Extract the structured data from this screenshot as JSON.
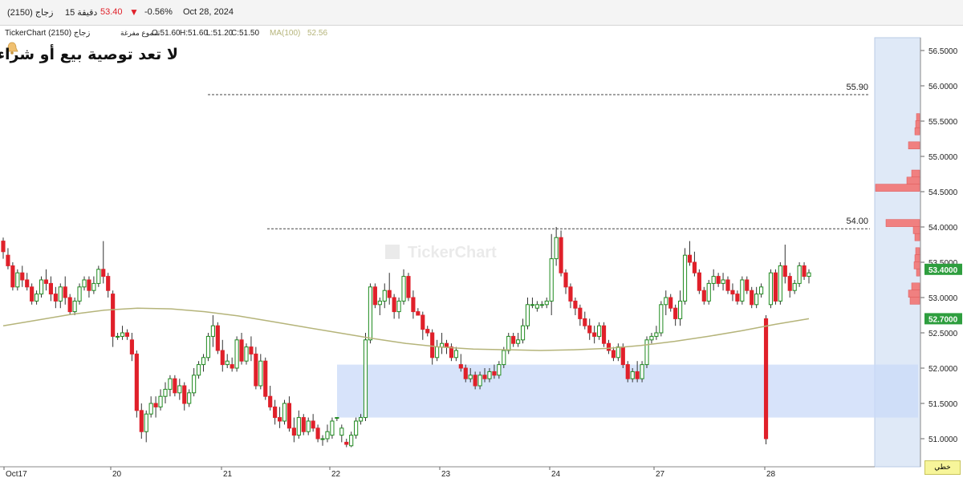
{
  "header": {
    "symbol": "(2150) زجاج",
    "interval": "15 دقيقة",
    "price": "53.40",
    "change": "-0.56%",
    "date": "Oct 28, 2024",
    "price_color": "#e0202a",
    "down_arrow_icon": "triangle-down-icon"
  },
  "legend": {
    "source": "TickerChart زجاج (2150)",
    "chart_type": "شموع مفرغة",
    "open": "O:51.60",
    "high": "H:51.60",
    "low": "L:51.20",
    "close": "C:51.50",
    "ma_label": "MA(100)",
    "ma_value": "52.56",
    "ma_color": "#b5b47a",
    "alert_icon": "bell-icon"
  },
  "disclaimer": "لا تعد توصية بيع أو شراء",
  "watermark": "TickerChart",
  "axis_mode": "خطي",
  "chart_data": {
    "type": "candlestick",
    "title": "",
    "y_ticks": [
      "51.0000",
      "51.5000",
      "52.0000",
      "52.5000",
      "53.0000",
      "53.5000",
      "54.0000",
      "54.5000",
      "55.0000",
      "55.5000",
      "56.0000",
      "56.5000"
    ],
    "ylim": [
      50.92,
      56.6
    ],
    "x_labels": [
      "Oct17",
      "20",
      "21",
      "22",
      "23",
      "24",
      "27",
      "28"
    ],
    "current_price_label": "53.4000",
    "ma_price_label": "52.7000",
    "horizontal_lines": [
      {
        "label": "55.90",
        "value": 55.875
      },
      {
        "label": "54.00",
        "value": 53.975
      }
    ],
    "zone": {
      "low": 51.3,
      "high": 52.05
    },
    "colors": {
      "up": "#1e8a1e",
      "down": "#e0202a",
      "ma": "#b5b47a",
      "zone": "#c9daf8",
      "profile": "#f08080",
      "current": "#2e9e3e"
    },
    "candles": [
      [
        53.8,
        53.85,
        53.55,
        53.65
      ],
      [
        53.6,
        53.7,
        53.4,
        53.45
      ],
      [
        53.45,
        53.5,
        53.1,
        53.15
      ],
      [
        53.15,
        53.4,
        53.1,
        53.35
      ],
      [
        53.35,
        53.45,
        53.15,
        53.25
      ],
      [
        53.25,
        53.35,
        53.1,
        53.15
      ],
      [
        53.15,
        53.2,
        52.9,
        52.95
      ],
      [
        52.95,
        53.1,
        52.9,
        53.05
      ],
      [
        53.05,
        53.3,
        53.0,
        53.25
      ],
      [
        53.25,
        53.4,
        53.1,
        53.2
      ],
      [
        53.2,
        53.3,
        52.95,
        53.05
      ],
      [
        53.05,
        53.15,
        52.85,
        52.95
      ],
      [
        52.95,
        53.2,
        52.85,
        53.15
      ],
      [
        53.15,
        53.3,
        52.9,
        53.0
      ],
      [
        53.0,
        53.05,
        52.75,
        52.8
      ],
      [
        52.8,
        53.0,
        52.75,
        52.95
      ],
      [
        52.95,
        53.2,
        52.9,
        53.15
      ],
      [
        53.15,
        53.3,
        53.1,
        53.25
      ],
      [
        53.25,
        53.3,
        53.0,
        53.1
      ],
      [
        53.1,
        53.3,
        53.05,
        53.2
      ],
      [
        53.2,
        53.45,
        53.15,
        53.4
      ],
      [
        53.4,
        53.8,
        53.2,
        53.3
      ],
      [
        53.3,
        53.35,
        53.0,
        53.1
      ],
      [
        53.05,
        53.1,
        52.3,
        52.45
      ],
      [
        52.45,
        52.5,
        52.4,
        52.45
      ],
      [
        52.45,
        52.6,
        52.4,
        52.5
      ],
      [
        52.5,
        52.55,
        52.4,
        52.45
      ],
      [
        52.4,
        52.5,
        52.1,
        52.2
      ],
      [
        52.2,
        52.25,
        51.3,
        51.4
      ],
      [
        51.4,
        51.5,
        51.0,
        51.1
      ],
      [
        51.1,
        51.4,
        50.95,
        51.35
      ],
      [
        51.35,
        51.6,
        51.3,
        51.5
      ],
      [
        51.5,
        51.6,
        51.3,
        51.45
      ],
      [
        51.45,
        51.7,
        51.4,
        51.6
      ],
      [
        51.6,
        51.8,
        51.5,
        51.7
      ],
      [
        51.7,
        51.9,
        51.6,
        51.85
      ],
      [
        51.85,
        51.9,
        51.6,
        51.65
      ],
      [
        51.65,
        51.85,
        51.55,
        51.75
      ],
      [
        51.75,
        51.8,
        51.4,
        51.5
      ],
      [
        51.5,
        51.7,
        51.45,
        51.65
      ],
      [
        51.65,
        52.0,
        51.6,
        51.9
      ],
      [
        51.9,
        52.1,
        51.85,
        52.05
      ],
      [
        52.05,
        52.2,
        51.95,
        52.15
      ],
      [
        52.15,
        52.5,
        52.1,
        52.45
      ],
      [
        52.45,
        52.75,
        52.3,
        52.6
      ],
      [
        52.6,
        52.65,
        52.2,
        52.25
      ],
      [
        52.25,
        52.4,
        51.95,
        52.05
      ],
      [
        52.05,
        52.2,
        52.0,
        52.1
      ],
      [
        52.05,
        52.15,
        51.95,
        52.0
      ],
      [
        52.0,
        52.45,
        51.95,
        52.4
      ],
      [
        52.4,
        52.5,
        52.05,
        52.1
      ],
      [
        52.1,
        52.35,
        52.05,
        52.3
      ],
      [
        52.3,
        52.45,
        52.1,
        52.2
      ],
      [
        52.2,
        52.3,
        51.7,
        51.75
      ],
      [
        51.75,
        52.2,
        51.7,
        52.1
      ],
      [
        52.1,
        52.15,
        51.55,
        51.6
      ],
      [
        51.6,
        51.75,
        51.4,
        51.45
      ],
      [
        51.45,
        51.55,
        51.2,
        51.3
      ],
      [
        51.3,
        51.45,
        51.15,
        51.25
      ],
      [
        51.25,
        51.55,
        51.2,
        51.5
      ],
      [
        51.5,
        51.6,
        51.1,
        51.15
      ],
      [
        51.15,
        51.3,
        50.95,
        51.05
      ],
      [
        51.05,
        51.4,
        51.0,
        51.3
      ],
      [
        51.3,
        51.35,
        51.05,
        51.1
      ],
      [
        51.1,
        51.3,
        51.05,
        51.25
      ],
      [
        51.25,
        51.35,
        51.1,
        51.15
      ],
      [
        51.15,
        51.2,
        50.95,
        51.0
      ],
      [
        51.0,
        51.05,
        50.9,
        51.0
      ],
      [
        51.0,
        51.2,
        50.95,
        51.1
      ],
      [
        51.05,
        51.3,
        51.0,
        51.25
      ],
      [
        51.3,
        51.3,
        51.25,
        51.3
      ],
      [
        51.05,
        51.2,
        50.95,
        51.15
      ],
      [
        50.95,
        51.0,
        50.88,
        50.92
      ],
      [
        50.9,
        51.1,
        50.88,
        51.05
      ],
      [
        51.05,
        51.3,
        51.0,
        51.25
      ],
      [
        51.25,
        51.35,
        51.2,
        51.3
      ],
      [
        51.3,
        52.5,
        51.25,
        52.4
      ],
      [
        52.4,
        53.2,
        52.35,
        53.15
      ],
      [
        53.15,
        53.2,
        52.85,
        52.9
      ],
      [
        52.9,
        53.0,
        52.75,
        52.95
      ],
      [
        52.95,
        53.2,
        52.85,
        53.1
      ],
      [
        53.1,
        53.35,
        52.9,
        53.0
      ],
      [
        53.0,
        53.05,
        52.7,
        52.8
      ],
      [
        52.8,
        53.0,
        52.7,
        52.95
      ],
      [
        52.95,
        53.4,
        52.9,
        53.3
      ],
      [
        53.3,
        53.35,
        52.95,
        53.0
      ],
      [
        53.0,
        53.1,
        52.7,
        52.8
      ],
      [
        52.8,
        52.85,
        52.75,
        52.75
      ],
      [
        52.75,
        52.8,
        52.4,
        52.55
      ],
      [
        52.55,
        52.6,
        52.45,
        52.5
      ],
      [
        52.5,
        52.55,
        52.05,
        52.15
      ],
      [
        52.15,
        52.4,
        52.1,
        52.3
      ],
      [
        52.3,
        52.5,
        52.2,
        52.35
      ],
      [
        52.35,
        52.4,
        52.2,
        52.3
      ],
      [
        52.3,
        52.35,
        52.1,
        52.15
      ],
      [
        52.15,
        52.3,
        52.1,
        52.25
      ],
      [
        52.05,
        52.2,
        51.95,
        52.0
      ],
      [
        52.0,
        52.05,
        51.8,
        51.85
      ],
      [
        51.85,
        52.0,
        51.8,
        51.9
      ],
      [
        51.9,
        51.95,
        51.7,
        51.75
      ],
      [
        51.75,
        51.95,
        51.7,
        51.9
      ],
      [
        51.9,
        52.0,
        51.8,
        51.85
      ],
      [
        51.85,
        52.0,
        51.8,
        51.95
      ],
      [
        51.95,
        52.05,
        51.85,
        51.9
      ],
      [
        51.9,
        52.1,
        51.85,
        52.05
      ],
      [
        52.05,
        52.3,
        52.0,
        52.25
      ],
      [
        52.25,
        52.5,
        52.2,
        52.45
      ],
      [
        52.45,
        52.5,
        52.3,
        52.35
      ],
      [
        52.35,
        52.5,
        52.3,
        52.4
      ],
      [
        52.4,
        52.7,
        52.35,
        52.6
      ],
      [
        52.6,
        53.0,
        52.55,
        52.9
      ],
      [
        52.9,
        53.0,
        52.85,
        52.9
      ],
      [
        52.85,
        52.95,
        52.8,
        52.9
      ],
      [
        52.9,
        52.95,
        52.85,
        52.9
      ],
      [
        52.9,
        53.0,
        52.85,
        52.95
      ],
      [
        52.95,
        53.9,
        52.75,
        53.55
      ],
      [
        53.55,
        54.0,
        53.45,
        53.85
      ],
      [
        53.85,
        53.95,
        53.3,
        53.35
      ],
      [
        53.35,
        53.4,
        53.05,
        53.15
      ],
      [
        53.15,
        53.2,
        52.85,
        52.95
      ],
      [
        52.95,
        53.0,
        52.75,
        52.85
      ],
      [
        52.85,
        52.9,
        52.6,
        52.7
      ],
      [
        52.7,
        52.8,
        52.55,
        52.6
      ],
      [
        52.6,
        52.7,
        52.4,
        52.5
      ],
      [
        52.5,
        52.6,
        52.35,
        52.45
      ],
      [
        52.45,
        52.65,
        52.4,
        52.6
      ],
      [
        52.6,
        52.65,
        52.3,
        52.35
      ],
      [
        52.35,
        52.4,
        52.2,
        52.25
      ],
      [
        52.25,
        52.3,
        52.1,
        52.15
      ],
      [
        52.15,
        52.35,
        52.1,
        52.3
      ],
      [
        52.3,
        52.35,
        52.0,
        52.05
      ],
      [
        52.05,
        52.1,
        51.8,
        51.85
      ],
      [
        51.85,
        52.0,
        51.8,
        51.95
      ],
      [
        51.95,
        52.1,
        51.8,
        51.85
      ],
      [
        51.85,
        52.1,
        51.8,
        52.05
      ],
      [
        52.05,
        52.45,
        52.0,
        52.4
      ],
      [
        52.4,
        52.5,
        52.35,
        52.45
      ],
      [
        52.45,
        52.6,
        52.4,
        52.5
      ],
      [
        52.5,
        52.95,
        52.45,
        52.9
      ],
      [
        52.9,
        53.1,
        52.75,
        53.0
      ],
      [
        53.0,
        53.05,
        52.8,
        52.85
      ],
      [
        52.85,
        52.9,
        52.6,
        52.7
      ],
      [
        52.7,
        53.1,
        52.6,
        52.95
      ],
      [
        52.95,
        53.7,
        52.9,
        53.6
      ],
      [
        53.6,
        53.8,
        53.45,
        53.5
      ],
      [
        53.5,
        53.65,
        53.3,
        53.35
      ],
      [
        53.35,
        53.4,
        53.05,
        53.1
      ],
      [
        53.1,
        53.15,
        52.9,
        52.95
      ],
      [
        52.95,
        53.25,
        52.9,
        53.2
      ],
      [
        53.2,
        53.4,
        53.1,
        53.3
      ],
      [
        53.3,
        53.35,
        53.15,
        53.2
      ],
      [
        53.2,
        53.35,
        53.1,
        53.25
      ],
      [
        53.25,
        53.3,
        53.05,
        53.1
      ],
      [
        53.1,
        53.2,
        52.95,
        53.05
      ],
      [
        53.05,
        53.1,
        52.9,
        52.95
      ],
      [
        52.95,
        53.3,
        52.9,
        53.25
      ],
      [
        53.25,
        53.3,
        53.05,
        53.1
      ],
      [
        53.1,
        53.15,
        52.85,
        52.9
      ],
      [
        52.9,
        53.15,
        52.85,
        53.05
      ],
      [
        53.05,
        53.2,
        53.0,
        53.15
      ],
      [
        52.7,
        52.75,
        50.92,
        51.0
      ],
      [
        52.9,
        53.4,
        52.85,
        53.35
      ],
      [
        53.35,
        53.4,
        52.9,
        52.95
      ],
      [
        52.95,
        53.5,
        52.9,
        53.45
      ],
      [
        53.45,
        53.75,
        53.2,
        53.3
      ],
      [
        53.3,
        53.35,
        53.0,
        53.1
      ],
      [
        53.1,
        53.25,
        53.05,
        53.2
      ],
      [
        53.2,
        53.5,
        53.15,
        53.45
      ],
      [
        53.45,
        53.5,
        53.25,
        53.3
      ],
      [
        53.3,
        53.4,
        53.2,
        53.35
      ]
    ],
    "moving_average": [
      52.6,
      52.68,
      52.76,
      52.82,
      52.85,
      52.84,
      52.8,
      52.74,
      52.66,
      52.58,
      52.5,
      52.42,
      52.35,
      52.3,
      52.27,
      52.26,
      52.25,
      52.26,
      52.28,
      52.32,
      52.38,
      52.45,
      52.53,
      52.62,
      52.7
    ],
    "volume_profile": [
      {
        "price": 55.55,
        "size": 4
      },
      {
        "price": 55.45,
        "size": 5
      },
      {
        "price": 55.35,
        "size": 6
      },
      {
        "price": 55.15,
        "size": 14
      },
      {
        "price": 54.75,
        "size": 10
      },
      {
        "price": 54.65,
        "size": 16
      },
      {
        "price": 54.55,
        "size": 55
      },
      {
        "price": 54.05,
        "size": 42
      },
      {
        "price": 53.95,
        "size": 8
      },
      {
        "price": 53.85,
        "size": 6
      },
      {
        "price": 53.65,
        "size": 5
      },
      {
        "price": 53.55,
        "size": 6
      },
      {
        "price": 53.45,
        "size": 7
      },
      {
        "price": 53.35,
        "size": 4
      },
      {
        "price": 53.15,
        "size": 10
      },
      {
        "price": 53.05,
        "size": 14
      },
      {
        "price": 52.95,
        "size": 12
      }
    ]
  }
}
